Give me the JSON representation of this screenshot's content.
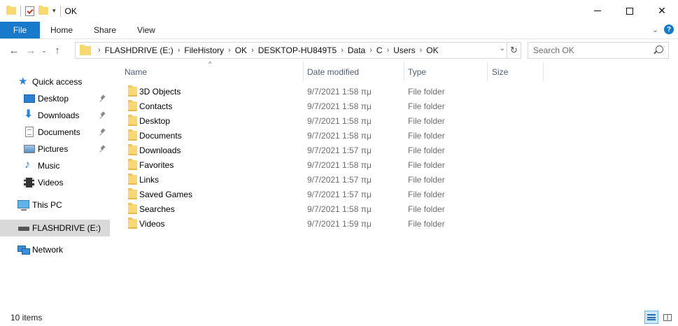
{
  "window": {
    "title": "OK",
    "minimize_glyph": "",
    "close_glyph": "✕"
  },
  "quick_access_toolbar": {
    "dropdown_glyph": "▾"
  },
  "ribbon": {
    "tabs": [
      {
        "label": "File"
      },
      {
        "label": "Home"
      },
      {
        "label": "Share"
      },
      {
        "label": "View"
      }
    ],
    "expand_glyph": "⌄",
    "help_glyph": "?"
  },
  "navigation": {
    "back_glyph": "←",
    "forward_glyph": "→",
    "recent_glyph": "⌄",
    "up_glyph": "↑",
    "breadcrumb": [
      "FLASHDRIVE (E:)",
      "FileHistory",
      "OK",
      "DESKTOP-HU849T5",
      "Data",
      "C",
      "Users",
      "OK"
    ],
    "crumb_separator": "›",
    "dropdown_glyph": "⌄",
    "refresh_glyph": "↻",
    "search_placeholder": "Search OK"
  },
  "sidebar": {
    "quick_access": {
      "label": "Quick access",
      "icon": "star-icon"
    },
    "pinned": [
      {
        "label": "Desktop",
        "icon": "desktop-icon",
        "pinned": true
      },
      {
        "label": "Downloads",
        "icon": "downloads-icon",
        "pinned": true
      },
      {
        "label": "Documents",
        "icon": "documents-icon",
        "pinned": true
      },
      {
        "label": "Pictures",
        "icon": "pictures-icon",
        "pinned": true
      },
      {
        "label": "Music",
        "icon": "music-icon",
        "pinned": false
      },
      {
        "label": "Videos",
        "icon": "videos-icon",
        "pinned": false
      }
    ],
    "this_pc": {
      "label": "This PC",
      "icon": "computer-icon"
    },
    "drive": {
      "label": "FLASHDRIVE (E:)",
      "icon": "drive-icon",
      "selected": true
    },
    "network": {
      "label": "Network",
      "icon": "network-icon"
    }
  },
  "file_list": {
    "columns": {
      "name": "Name",
      "date_modified": "Date modified",
      "type": "Type",
      "size": "Size"
    },
    "sort_glyph": "^",
    "rows": [
      {
        "name": "3D Objects",
        "date": "9/7/2021 1:58 πμ",
        "type": "File folder"
      },
      {
        "name": "Contacts",
        "date": "9/7/2021 1:58 πμ",
        "type": "File folder"
      },
      {
        "name": "Desktop",
        "date": "9/7/2021 1:58 πμ",
        "type": "File folder"
      },
      {
        "name": "Documents",
        "date": "9/7/2021 1:58 πμ",
        "type": "File folder"
      },
      {
        "name": "Downloads",
        "date": "9/7/2021 1:57 πμ",
        "type": "File folder"
      },
      {
        "name": "Favorites",
        "date": "9/7/2021 1:58 πμ",
        "type": "File folder"
      },
      {
        "name": "Links",
        "date": "9/7/2021 1:57 πμ",
        "type": "File folder"
      },
      {
        "name": "Saved Games",
        "date": "9/7/2021 1:57 πμ",
        "type": "File folder"
      },
      {
        "name": "Searches",
        "date": "9/7/2021 1:58 πμ",
        "type": "File folder"
      },
      {
        "name": "Videos",
        "date": "9/7/2021 1:59 πμ",
        "type": "File folder"
      }
    ]
  },
  "status_bar": {
    "item_count": "10 items"
  },
  "colors": {
    "file_tab": "#1979ca",
    "folder": "#f8d775",
    "selected_nav": "#d9d9d9",
    "header_text": "#4c607a",
    "view_active": "#cce8ff"
  }
}
